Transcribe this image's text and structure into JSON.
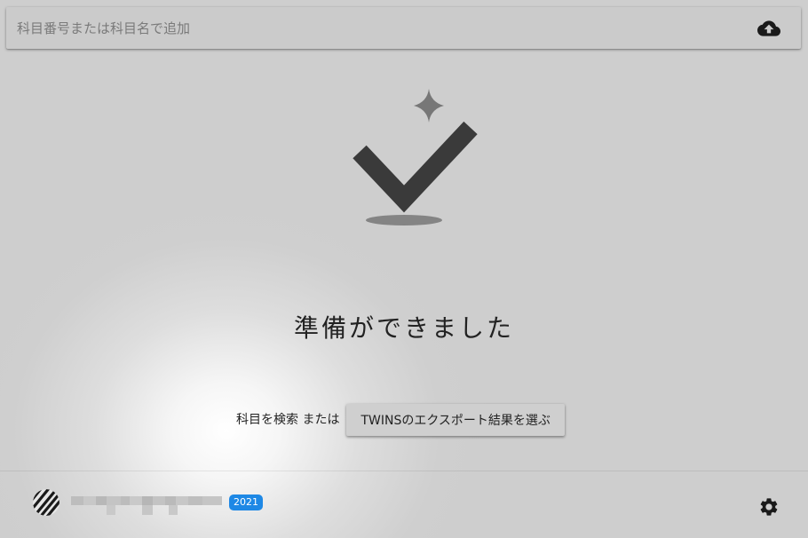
{
  "search": {
    "placeholder": "科目番号または科目名で追加"
  },
  "icons": {
    "upload": "cloud-upload-icon",
    "hero": "checkmark-sparkle-icon",
    "settings": "gear-icon",
    "avatar": "striped-circle-avatar"
  },
  "main": {
    "title": "準備ができました",
    "prefix": "科目を検索 または",
    "export_button": "TWINSのエクスポート結果を選ぶ"
  },
  "footer": {
    "year_badge": "2021"
  },
  "colors": {
    "background": "#cecece",
    "badge": "#1e88e5",
    "icon": "#3a3a3a",
    "sparkle": "#777777"
  }
}
